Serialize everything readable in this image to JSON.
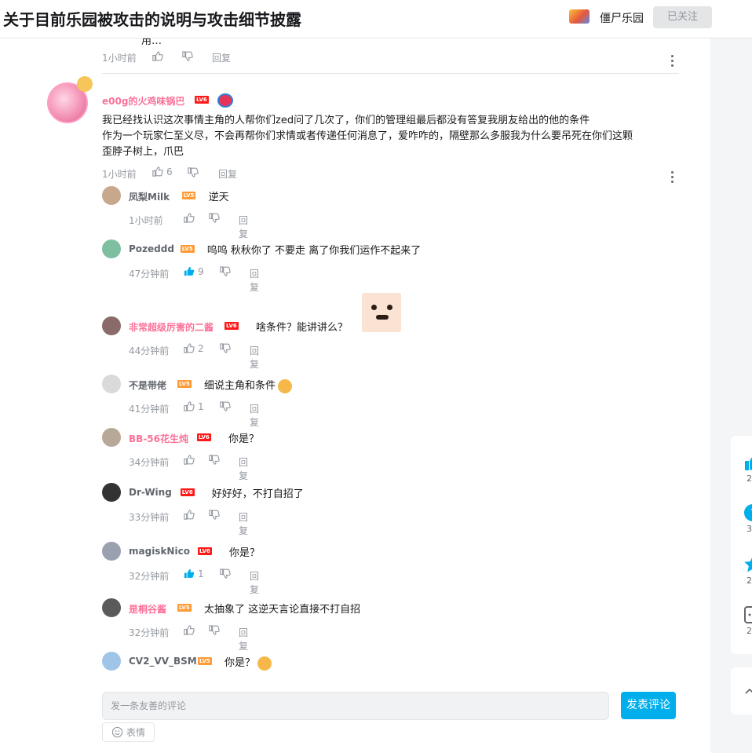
{
  "header": {
    "title": "关于目前乐园被攻击的说明与攻击细节披露",
    "up_name": "僵尸乐园",
    "follow_label": "已关注"
  },
  "top_comment": {
    "partial_text": "用…",
    "time": "1小时前",
    "reply_label": "回复"
  },
  "main_comment": {
    "user": "e00g的火鸡味锅巴",
    "level": "LV6",
    "text_line1": "我已经找认识这次事情主角的人帮你们zed问了几次了，你们的管理组最后都没有答复我朋友给出的他的条件",
    "text_line2": "作为一个玩家仁至义尽，不会再帮你们求情或者传递任何消息了，爱咋咋的，隔壁那么多服我为什么要吊死在你们这颗",
    "text_line3": "歪脖子树上，爪巴",
    "time": "1小时前",
    "likes": "6",
    "reply_label": "回复"
  },
  "replies": [
    {
      "user": "凤梨Milk",
      "level": "LV5",
      "text": "逆天",
      "time": "1小时前",
      "likes": "",
      "liked": false,
      "reply_label": "回复",
      "name_color": "gray"
    },
    {
      "user": "Pozeddd",
      "level": "LV5",
      "text": "呜呜 秋秋你了 不要走 离了你我们运作不起来了",
      "time": "47分钟前",
      "likes": "9",
      "liked": true,
      "reply_label": "回复",
      "name_color": "gray"
    },
    {
      "user": "非常超级厉害的二酱",
      "level": "LV6",
      "text": "啥条件？能讲讲么？",
      "time": "44分钟前",
      "likes": "2",
      "liked": false,
      "reply_label": "回复",
      "name_color": "pink"
    },
    {
      "user": "不是带佬",
      "level": "LV5",
      "text": "细说主角和条件",
      "time": "41分钟前",
      "likes": "1",
      "liked": false,
      "reply_label": "回复",
      "name_color": "gray"
    },
    {
      "user": "BB-56花生炖",
      "level": "LV6",
      "text": "你是？",
      "time": "34分钟前",
      "likes": "",
      "liked": false,
      "reply_label": "回复",
      "name_color": "pink"
    },
    {
      "user": "Dr-Wing",
      "level": "LV6",
      "text": "好好好，不打自招了",
      "time": "33分钟前",
      "likes": "",
      "liked": false,
      "reply_label": "回复",
      "name_color": "gray"
    },
    {
      "user": "magiskNico",
      "level": "LV6",
      "text": "你是？",
      "time": "32分钟前",
      "likes": "1",
      "liked": true,
      "reply_label": "回复",
      "name_color": "gray"
    },
    {
      "user": "是桐谷酱",
      "level": "LV5",
      "text": "太抽象了 这逆天言论直接不打自招",
      "time": "32分钟前",
      "likes": "",
      "liked": false,
      "reply_label": "回复",
      "name_color": "pink"
    },
    {
      "user": "CV2_VV_BSM",
      "level": "LV5",
      "text": "你是？",
      "time": "",
      "likes": "",
      "liked": false,
      "reply_label": "",
      "name_color": "gray"
    }
  ],
  "composer": {
    "placeholder": "发一条友善的评论",
    "send_label": "发表评论",
    "emoji_label": "表情"
  },
  "side_panel": {
    "counts": [
      "2",
      "3",
      "2",
      "2"
    ]
  },
  "colors": {
    "accent": "#00aeec",
    "pink": "#fb7299",
    "level6": "#ff1a1a",
    "level5": "#ff9b37"
  }
}
